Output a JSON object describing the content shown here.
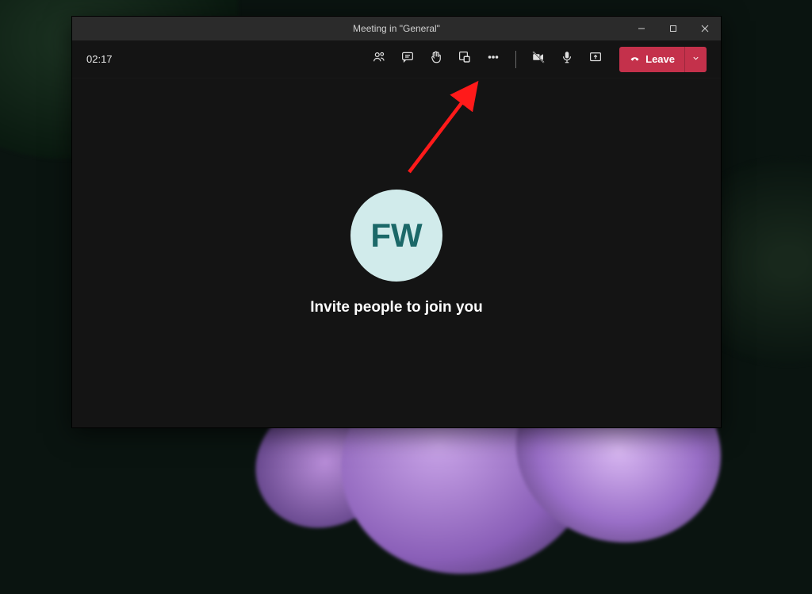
{
  "titlebar": {
    "title": "Meeting in \"General\""
  },
  "toolbar": {
    "timer": "02:17",
    "leave_label": "Leave"
  },
  "content": {
    "avatar_initials": "FW",
    "invite_text": "Invite people to join you"
  }
}
